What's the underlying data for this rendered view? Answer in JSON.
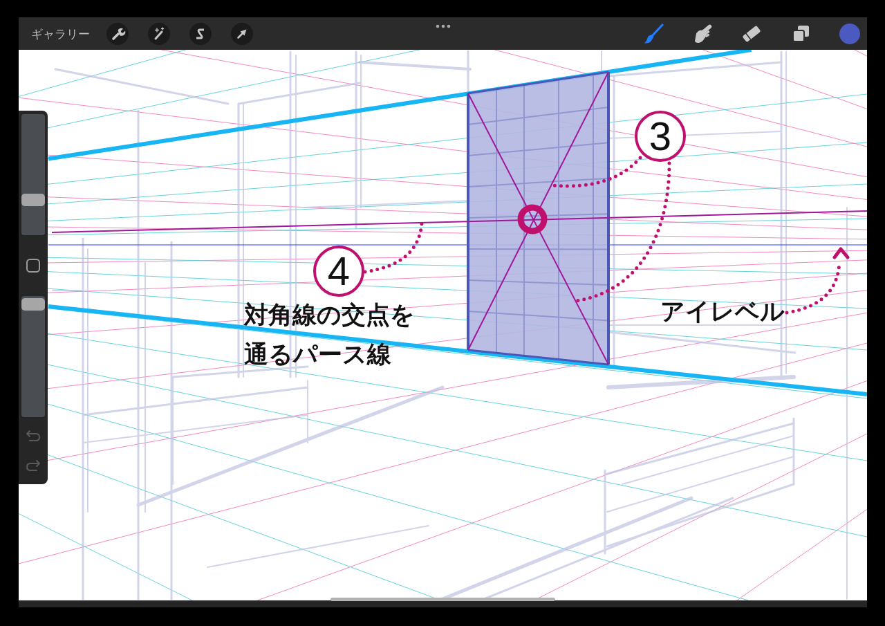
{
  "toolbar": {
    "gallery": "ギャラリー",
    "actions": [
      {
        "kind": "wrench"
      },
      {
        "kind": "wand"
      },
      {
        "kind": "selection"
      },
      {
        "kind": "transform"
      }
    ],
    "tools": [
      {
        "kind": "brush",
        "selected": true
      },
      {
        "kind": "smudge",
        "selected": false
      },
      {
        "kind": "eraser",
        "selected": false
      }
    ]
  },
  "sidebar": {
    "sliders": [
      {
        "level": 0.27
      },
      {
        "level": 0.98
      }
    ]
  },
  "canvas": {
    "callouts": [
      {
        "number": "3"
      },
      {
        "number": "4"
      }
    ],
    "labels": [
      {
        "text": "対角線の交点を通るパース線"
      },
      {
        "text": "アイレベル"
      }
    ]
  }
}
